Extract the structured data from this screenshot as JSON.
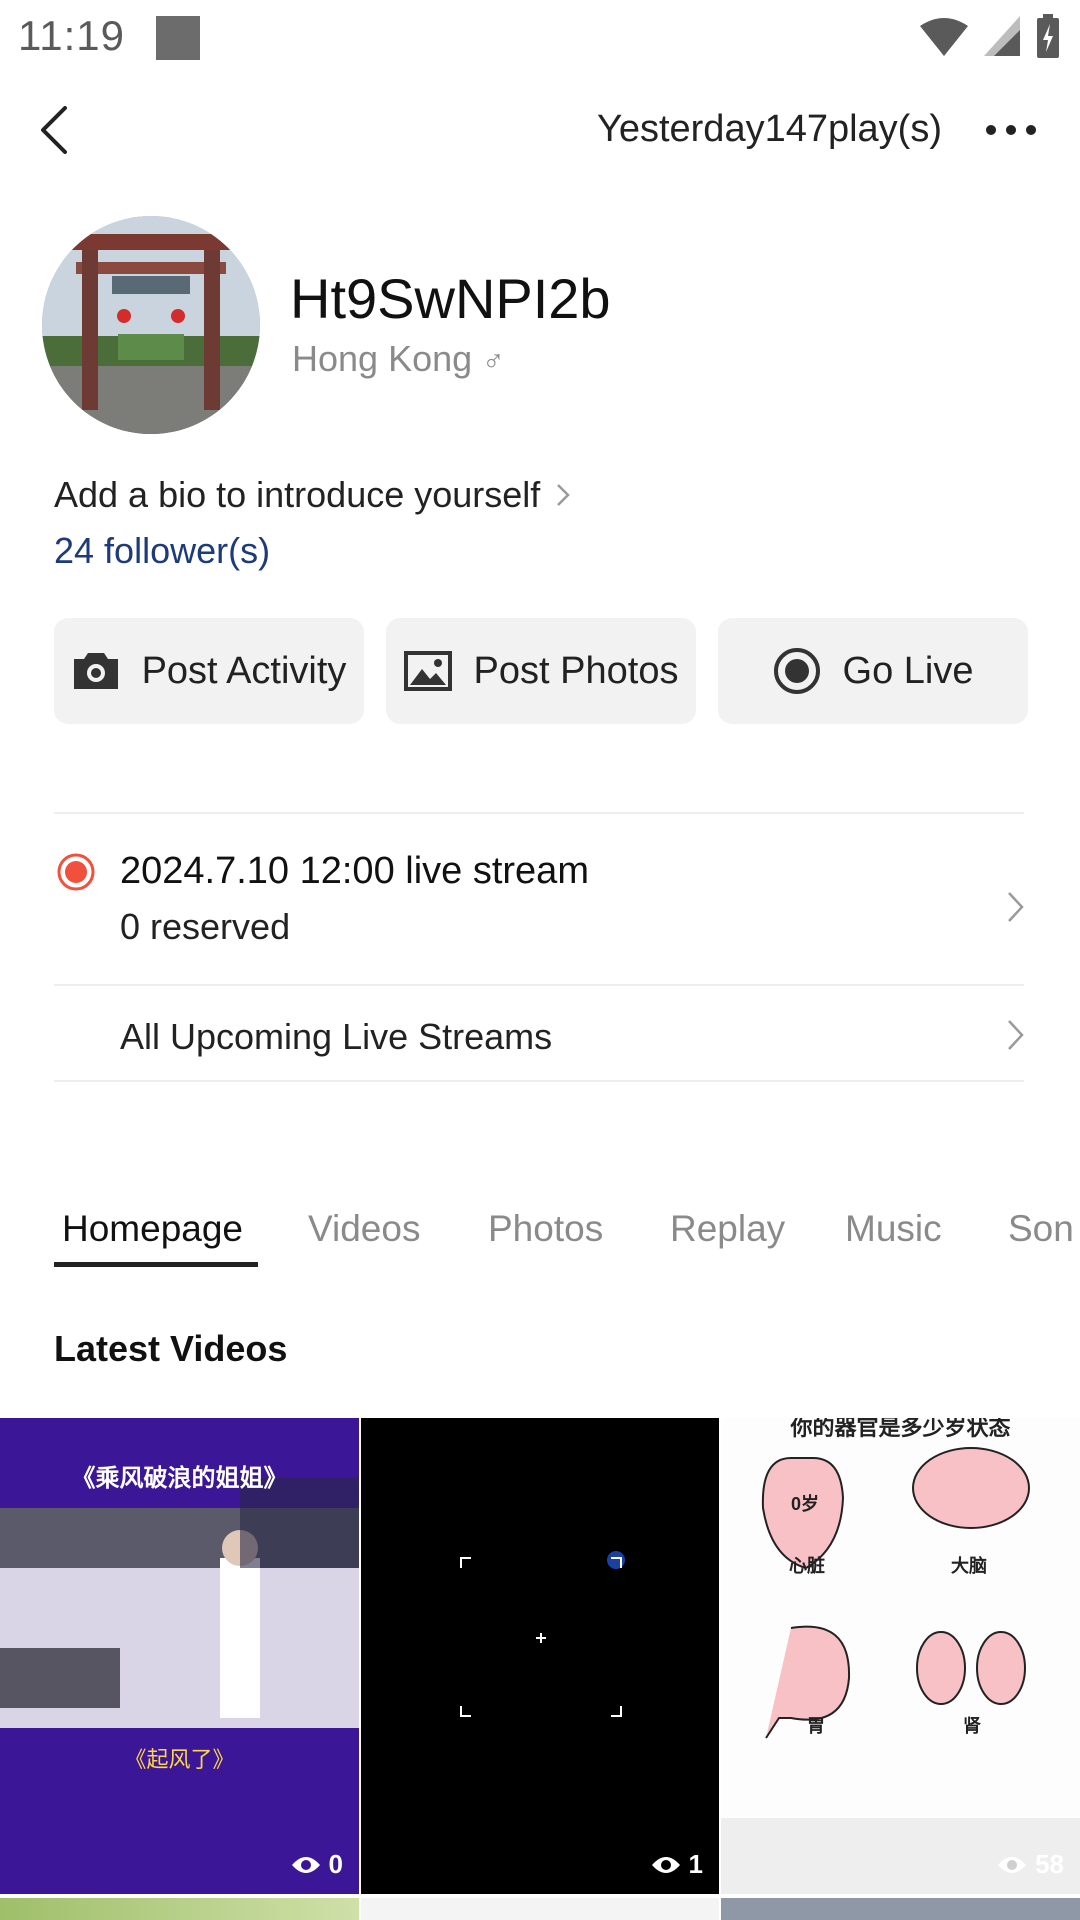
{
  "status": {
    "time": "11:19"
  },
  "header": {
    "plays": "Yesterday147play(s)"
  },
  "profile": {
    "username": "Ht9SwNPI2b",
    "location": "Hong Kong",
    "gender": "♂",
    "bio_prompt": "Add a bio to introduce yourself",
    "followers": "24 follower(s)"
  },
  "actions": [
    {
      "label": "Post Activity",
      "icon": "camera-icon"
    },
    {
      "label": "Post Photos",
      "icon": "image-icon"
    },
    {
      "label": "Go Live",
      "icon": "record-icon"
    }
  ],
  "live": {
    "title": "2024.7.10 12:00 live stream",
    "reserved": "0 reserved",
    "upcoming": "All Upcoming Live Streams"
  },
  "tabs": [
    "Homepage",
    "Videos",
    "Photos",
    "Replay",
    "Music",
    "Son"
  ],
  "latest_videos": {
    "title": "Latest Videos",
    "items": [
      {
        "views": "0",
        "caption_top": "《乘风破浪的姐姐》",
        "caption_bottom": "《起风了》"
      },
      {
        "views": "1"
      },
      {
        "views": "58",
        "caption_top": "你的器官是多少岁状态",
        "labels": [
          "0岁",
          "心脏",
          "大脑",
          "胃",
          "肾"
        ]
      }
    ]
  },
  "colors": {
    "accent_link": "#1d3a7a",
    "live_red": "#f0503c"
  }
}
